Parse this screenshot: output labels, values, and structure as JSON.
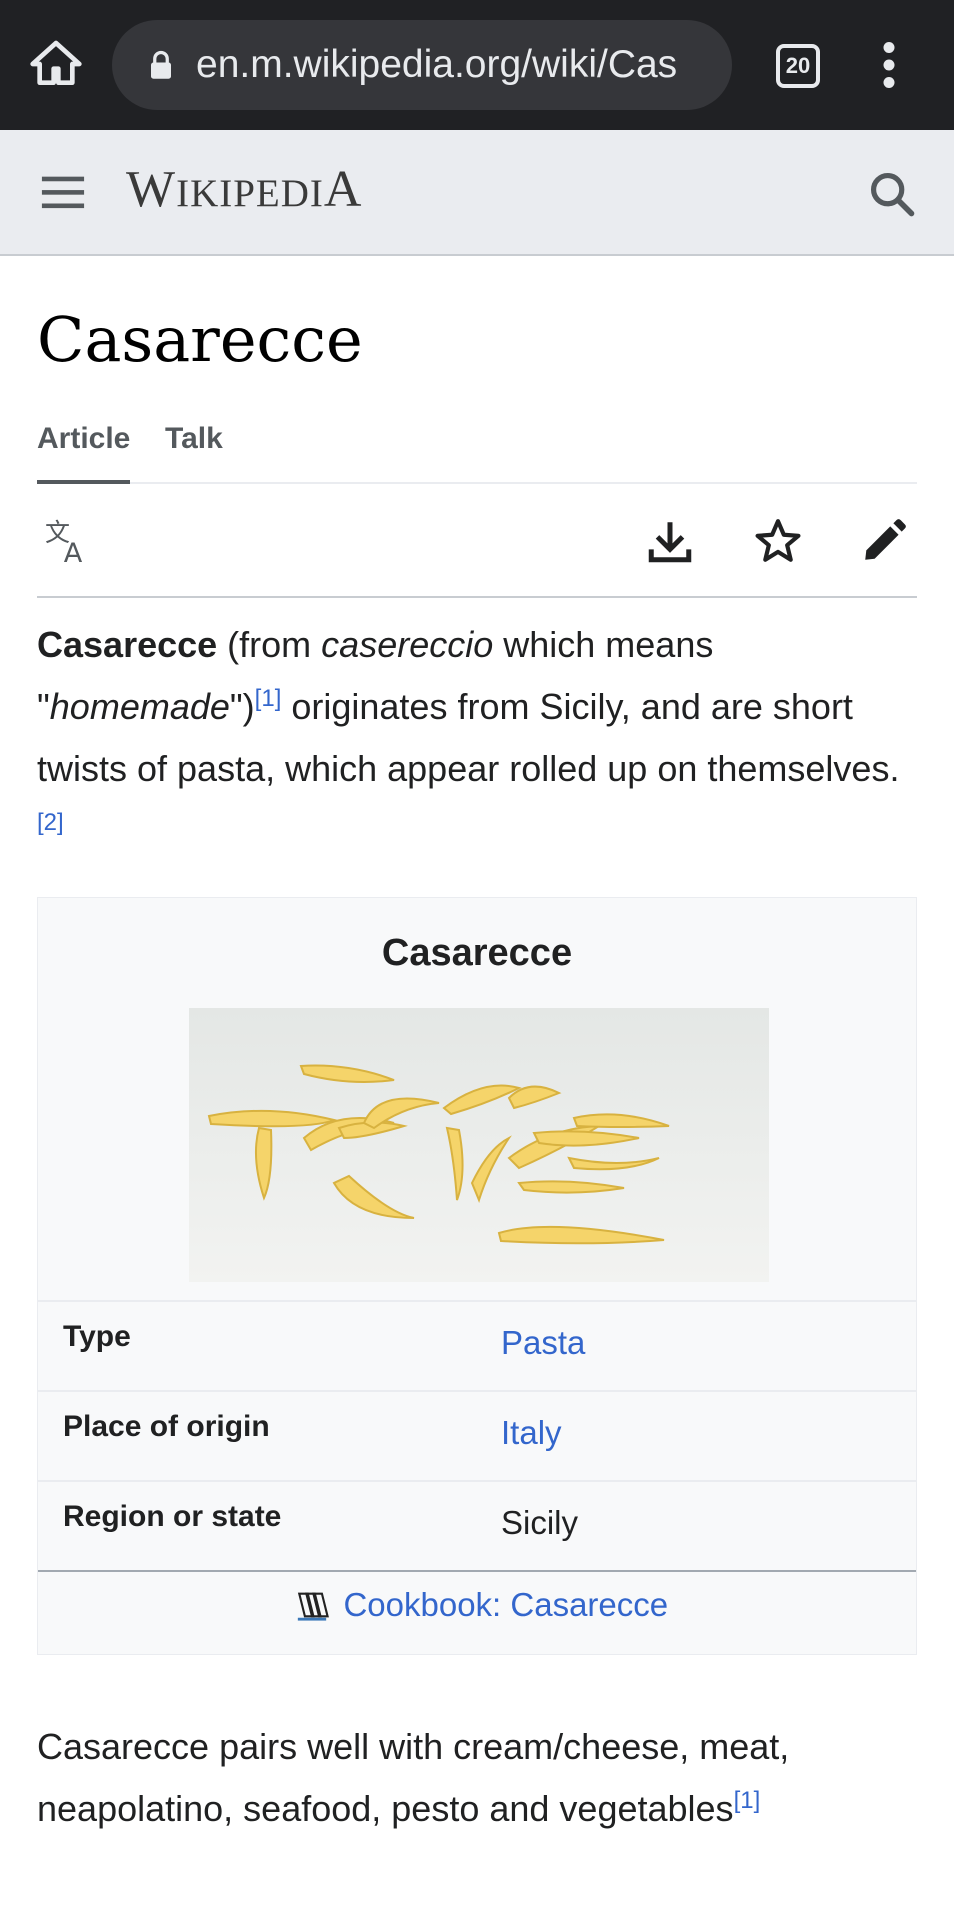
{
  "browser": {
    "url": "en.m.wikipedia.org/wiki/Cas",
    "tab_count": "20"
  },
  "header": {
    "wordmark_parts": [
      "W",
      "IKIPEDI",
      "A"
    ]
  },
  "article": {
    "title": "Casarecce",
    "tabs": [
      "Article",
      "Talk"
    ],
    "intro": {
      "bold": "Casarecce",
      "t1": " (from ",
      "italic1": "casereccio",
      "t2": " which means \"",
      "italic2": "homemade",
      "t3": "\")",
      "ref1": "[1]",
      "t4": " originates from Sicily, and are short twists of pasta, which appear rolled up on themselves.",
      "ref2": "[2]"
    },
    "second_para": {
      "text": "Casarecce pairs well with cream/cheese, meat, neapolatino, seafood, pesto and vegetables",
      "ref": "[1]"
    }
  },
  "infobox": {
    "title": "Casarecce",
    "rows": [
      {
        "label": "Type",
        "value": "Pasta"
      },
      {
        "label": "Place of origin",
        "value": "Italy"
      },
      {
        "label": "Region or state",
        "value": "Sicily"
      }
    ],
    "footer_link": "Cookbook: Casarecce"
  },
  "colors": {
    "link": "#3366cc",
    "browser_bar": "#202124",
    "header_bg": "#eaecf0"
  },
  "icons": [
    "home-icon",
    "lock-icon",
    "more-vert-icon",
    "hamburger-icon",
    "search-icon",
    "translate-icon",
    "download-icon",
    "star-icon",
    "edit-icon",
    "cookbook-icon"
  ]
}
